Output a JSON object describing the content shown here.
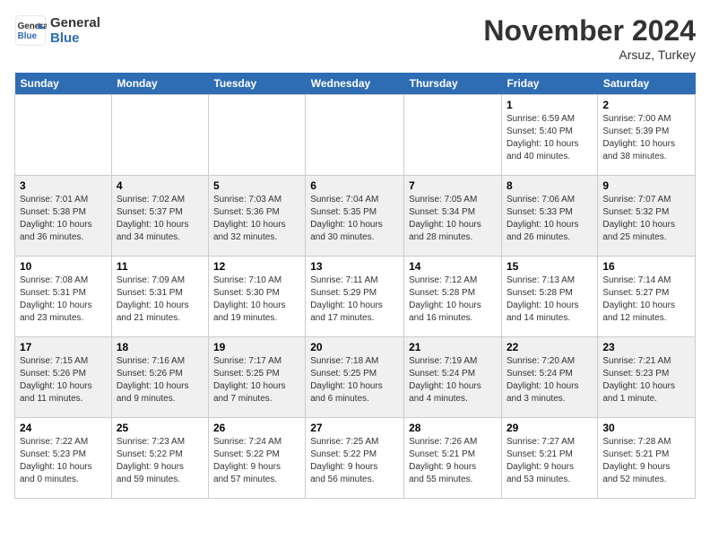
{
  "header": {
    "logo_line1": "General",
    "logo_line2": "Blue",
    "month": "November 2024",
    "location": "Arsuz, Turkey"
  },
  "days_of_week": [
    "Sunday",
    "Monday",
    "Tuesday",
    "Wednesday",
    "Thursday",
    "Friday",
    "Saturday"
  ],
  "weeks": [
    [
      {
        "day": "",
        "info": ""
      },
      {
        "day": "",
        "info": ""
      },
      {
        "day": "",
        "info": ""
      },
      {
        "day": "",
        "info": ""
      },
      {
        "day": "",
        "info": ""
      },
      {
        "day": "1",
        "info": "Sunrise: 6:59 AM\nSunset: 5:40 PM\nDaylight: 10 hours\nand 40 minutes."
      },
      {
        "day": "2",
        "info": "Sunrise: 7:00 AM\nSunset: 5:39 PM\nDaylight: 10 hours\nand 38 minutes."
      }
    ],
    [
      {
        "day": "3",
        "info": "Sunrise: 7:01 AM\nSunset: 5:38 PM\nDaylight: 10 hours\nand 36 minutes."
      },
      {
        "day": "4",
        "info": "Sunrise: 7:02 AM\nSunset: 5:37 PM\nDaylight: 10 hours\nand 34 minutes."
      },
      {
        "day": "5",
        "info": "Sunrise: 7:03 AM\nSunset: 5:36 PM\nDaylight: 10 hours\nand 32 minutes."
      },
      {
        "day": "6",
        "info": "Sunrise: 7:04 AM\nSunset: 5:35 PM\nDaylight: 10 hours\nand 30 minutes."
      },
      {
        "day": "7",
        "info": "Sunrise: 7:05 AM\nSunset: 5:34 PM\nDaylight: 10 hours\nand 28 minutes."
      },
      {
        "day": "8",
        "info": "Sunrise: 7:06 AM\nSunset: 5:33 PM\nDaylight: 10 hours\nand 26 minutes."
      },
      {
        "day": "9",
        "info": "Sunrise: 7:07 AM\nSunset: 5:32 PM\nDaylight: 10 hours\nand 25 minutes."
      }
    ],
    [
      {
        "day": "10",
        "info": "Sunrise: 7:08 AM\nSunset: 5:31 PM\nDaylight: 10 hours\nand 23 minutes."
      },
      {
        "day": "11",
        "info": "Sunrise: 7:09 AM\nSunset: 5:31 PM\nDaylight: 10 hours\nand 21 minutes."
      },
      {
        "day": "12",
        "info": "Sunrise: 7:10 AM\nSunset: 5:30 PM\nDaylight: 10 hours\nand 19 minutes."
      },
      {
        "day": "13",
        "info": "Sunrise: 7:11 AM\nSunset: 5:29 PM\nDaylight: 10 hours\nand 17 minutes."
      },
      {
        "day": "14",
        "info": "Sunrise: 7:12 AM\nSunset: 5:28 PM\nDaylight: 10 hours\nand 16 minutes."
      },
      {
        "day": "15",
        "info": "Sunrise: 7:13 AM\nSunset: 5:28 PM\nDaylight: 10 hours\nand 14 minutes."
      },
      {
        "day": "16",
        "info": "Sunrise: 7:14 AM\nSunset: 5:27 PM\nDaylight: 10 hours\nand 12 minutes."
      }
    ],
    [
      {
        "day": "17",
        "info": "Sunrise: 7:15 AM\nSunset: 5:26 PM\nDaylight: 10 hours\nand 11 minutes."
      },
      {
        "day": "18",
        "info": "Sunrise: 7:16 AM\nSunset: 5:26 PM\nDaylight: 10 hours\nand 9 minutes."
      },
      {
        "day": "19",
        "info": "Sunrise: 7:17 AM\nSunset: 5:25 PM\nDaylight: 10 hours\nand 7 minutes."
      },
      {
        "day": "20",
        "info": "Sunrise: 7:18 AM\nSunset: 5:25 PM\nDaylight: 10 hours\nand 6 minutes."
      },
      {
        "day": "21",
        "info": "Sunrise: 7:19 AM\nSunset: 5:24 PM\nDaylight: 10 hours\nand 4 minutes."
      },
      {
        "day": "22",
        "info": "Sunrise: 7:20 AM\nSunset: 5:24 PM\nDaylight: 10 hours\nand 3 minutes."
      },
      {
        "day": "23",
        "info": "Sunrise: 7:21 AM\nSunset: 5:23 PM\nDaylight: 10 hours\nand 1 minute."
      }
    ],
    [
      {
        "day": "24",
        "info": "Sunrise: 7:22 AM\nSunset: 5:23 PM\nDaylight: 10 hours\nand 0 minutes."
      },
      {
        "day": "25",
        "info": "Sunrise: 7:23 AM\nSunset: 5:22 PM\nDaylight: 9 hours\nand 59 minutes."
      },
      {
        "day": "26",
        "info": "Sunrise: 7:24 AM\nSunset: 5:22 PM\nDaylight: 9 hours\nand 57 minutes."
      },
      {
        "day": "27",
        "info": "Sunrise: 7:25 AM\nSunset: 5:22 PM\nDaylight: 9 hours\nand 56 minutes."
      },
      {
        "day": "28",
        "info": "Sunrise: 7:26 AM\nSunset: 5:21 PM\nDaylight: 9 hours\nand 55 minutes."
      },
      {
        "day": "29",
        "info": "Sunrise: 7:27 AM\nSunset: 5:21 PM\nDaylight: 9 hours\nand 53 minutes."
      },
      {
        "day": "30",
        "info": "Sunrise: 7:28 AM\nSunset: 5:21 PM\nDaylight: 9 hours\nand 52 minutes."
      }
    ]
  ]
}
